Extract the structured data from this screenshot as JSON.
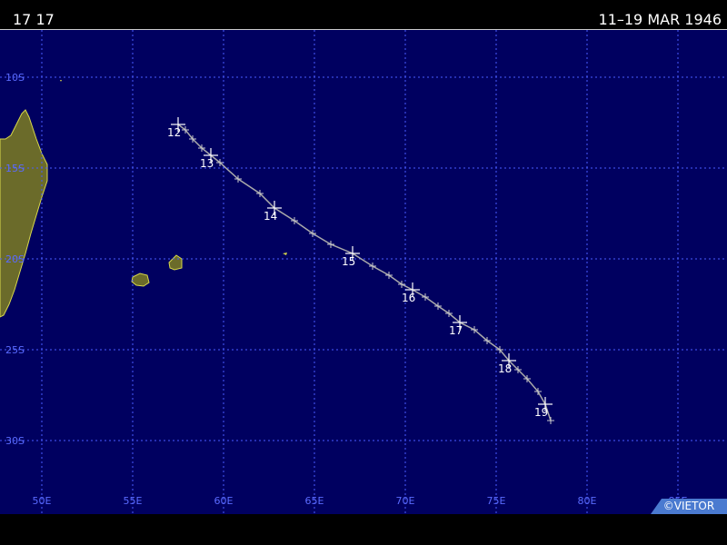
{
  "header": {
    "storm_id": "17 17",
    "date_range": "11–19 MAR 1946"
  },
  "map": {
    "lat_labels": [
      "10S",
      "15S",
      "20S",
      "25S",
      "30S"
    ],
    "lon_labels": [
      "50E",
      "55E",
      "60E",
      "65E",
      "70E",
      "75E",
      "80E",
      "85E"
    ],
    "colors": {
      "ocean": "#000060",
      "grid": "#4a5cff",
      "land": "#6b6b2a",
      "land_outline": "#d8d84a",
      "track": "#aaaaaa"
    },
    "track": {
      "points": [
        {
          "lon": 57.5,
          "lat": -12.6
        },
        {
          "lon": 57.9,
          "lat": -12.9
        },
        {
          "lon": 58.3,
          "lat": -13.4
        },
        {
          "lon": 58.8,
          "lat": -13.9
        },
        {
          "lon": 59.3,
          "lat": -14.3
        },
        {
          "lon": 59.8,
          "lat": -14.7
        },
        {
          "lon": 60.8,
          "lat": -15.6
        },
        {
          "lon": 62.0,
          "lat": -16.4
        },
        {
          "lon": 62.8,
          "lat": -17.2
        },
        {
          "lon": 63.9,
          "lat": -17.9
        },
        {
          "lon": 64.9,
          "lat": -18.6
        },
        {
          "lon": 65.9,
          "lat": -19.2
        },
        {
          "lon": 67.1,
          "lat": -19.7
        },
        {
          "lon": 68.2,
          "lat": -20.4
        },
        {
          "lon": 69.1,
          "lat": -20.9
        },
        {
          "lon": 69.8,
          "lat": -21.4
        },
        {
          "lon": 70.4,
          "lat": -21.7
        },
        {
          "lon": 71.1,
          "lat": -22.1
        },
        {
          "lon": 71.8,
          "lat": -22.6
        },
        {
          "lon": 72.4,
          "lat": -23.0
        },
        {
          "lon": 73.0,
          "lat": -23.5
        },
        {
          "lon": 73.8,
          "lat": -23.9
        },
        {
          "lon": 74.5,
          "lat": -24.5
        },
        {
          "lon": 75.2,
          "lat": -25.0
        },
        {
          "lon": 75.7,
          "lat": -25.6
        },
        {
          "lon": 76.2,
          "lat": -26.1
        },
        {
          "lon": 76.7,
          "lat": -26.6
        },
        {
          "lon": 77.3,
          "lat": -27.3
        },
        {
          "lon": 77.7,
          "lat": -28.0
        },
        {
          "lon": 78.0,
          "lat": -28.9
        }
      ],
      "day_marks": [
        {
          "label": "12",
          "lon": 57.5,
          "lat": -12.6
        },
        {
          "label": "13",
          "lon": 59.3,
          "lat": -14.3
        },
        {
          "label": "14",
          "lon": 62.8,
          "lat": -17.2
        },
        {
          "label": "15",
          "lon": 67.1,
          "lat": -19.7
        },
        {
          "label": "16",
          "lon": 70.4,
          "lat": -21.7
        },
        {
          "label": "17",
          "lon": 73.0,
          "lat": -23.5
        },
        {
          "label": "18",
          "lon": 75.7,
          "lat": -25.6
        },
        {
          "label": "19",
          "lon": 77.7,
          "lat": -28.0
        }
      ]
    }
  },
  "credit": "©VIETOR"
}
